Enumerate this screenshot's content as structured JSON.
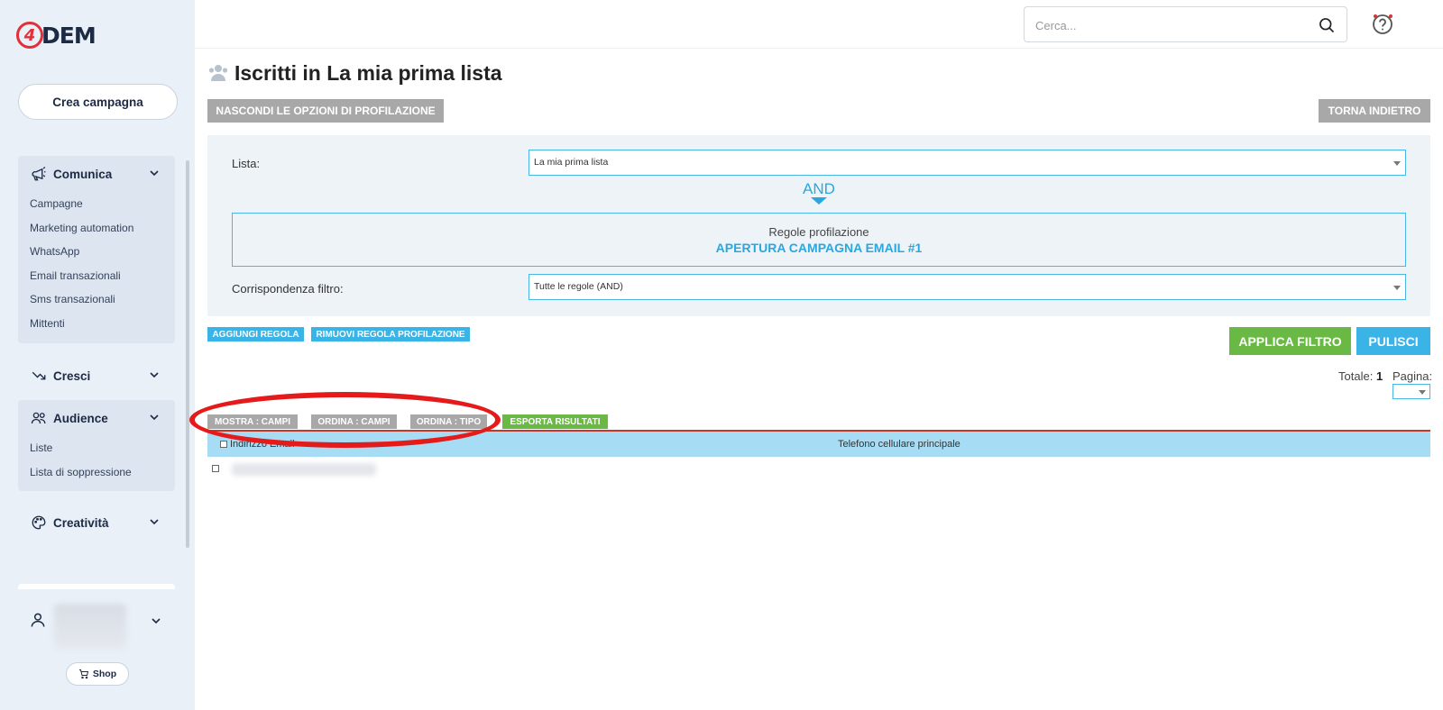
{
  "brand": {
    "logo_mark": "4",
    "logo_text": "DEM"
  },
  "sidebar": {
    "cta": "Crea campagna",
    "groups": [
      {
        "label": "Comunica",
        "icon": "megaphone-icon",
        "items": [
          "Campagne",
          "Marketing automation",
          "WhatsApp",
          "Email transazionali",
          "Sms transazionali",
          "Mittenti"
        ]
      },
      {
        "label": "Cresci",
        "icon": "trend-icon",
        "items": []
      },
      {
        "label": "Audience",
        "icon": "users-icon",
        "items": [
          "Liste",
          "Lista di soppressione"
        ]
      },
      {
        "label": "Creatività",
        "icon": "palette-icon",
        "items": []
      }
    ],
    "shop": "Shop"
  },
  "search": {
    "placeholder": "Cerca..."
  },
  "page": {
    "title": "Iscritti in La mia prima lista",
    "hide_profiling": "NASCONDI LE OPZIONI DI PROFILAZIONE",
    "back": "TORNA INDIETRO"
  },
  "filter": {
    "list_label": "Lista:",
    "list_value": "La mia prima lista",
    "and": "AND",
    "rules_title": "Regole profilazione",
    "rules_value": "APERTURA CAMPAGNA EMAIL #1",
    "match_label": "Corrispondenza filtro:",
    "match_value": "Tutte le regole (AND)"
  },
  "actions": {
    "add_rule": "AGGIUNGI REGOLA",
    "remove_rule": "RIMUOVI REGOLA PROFILAZIONE",
    "apply": "APPLICA FILTRO",
    "clear": "PULISCI"
  },
  "results": {
    "total_label": "Totale:",
    "total_value": "1",
    "page_label": "Pagina:",
    "show_fields": "MOSTRA : CAMPI",
    "order_fields": "ORDINA : CAMPI",
    "order_type": "ORDINA : TIPO",
    "export": "ESPORTA RISULTATI",
    "columns": [
      "Indirizzo Email",
      "Telefono cellulare principale"
    ]
  },
  "colors": {
    "accent_blue": "#29a8df",
    "green": "#6ab944",
    "gray_button": "#a8a8a8",
    "annotation_red": "#e51b1b"
  }
}
